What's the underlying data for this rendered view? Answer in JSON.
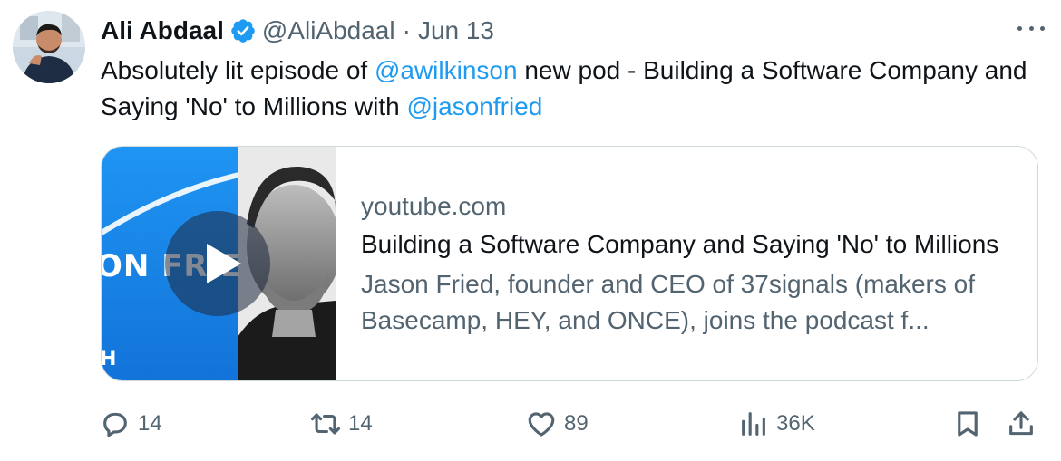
{
  "tweet": {
    "author_name": "Ali Abdaal",
    "handle": "@AliAbdaal",
    "separator": "·",
    "date": "Jun 13",
    "text_parts": [
      "Absolutely lit episode of ",
      "@awilkinson",
      " new pod - Building a Software Company and Saying 'No' to Millions with ",
      "@jasonfried"
    ],
    "icons": {
      "verified": "verified-badge-icon",
      "more": "more-options-icon"
    }
  },
  "card": {
    "domain": "youtube.com",
    "title": "Building a Software Company and Saying 'No' to Millions",
    "description": "Jason Fried, founder and CEO of 37signals (makers of Basecamp, HEY, and ONCE), joins the podcast f...",
    "thumb_text": "ON FRIE",
    "thumb_text2": "H",
    "play_icon": "play-icon"
  },
  "actions": {
    "replies": "14",
    "retweets": "14",
    "likes": "89",
    "views": "36K"
  },
  "colors": {
    "accent": "#1d9bf0",
    "text": "#0f1419",
    "muted": "#536471",
    "border": "#cfd9de",
    "thumb_blue": "#1a8cf0"
  }
}
